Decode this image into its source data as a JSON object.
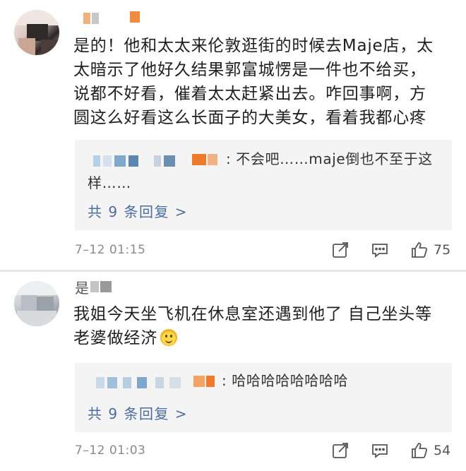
{
  "comments": [
    {
      "text": "是的！他和太太来伦敦逛街的时候去Maje店，太\n太暗示了他好久结果郭富城愣是一件也不给买，\n说都不好看，催着太太赶紧出去。咋回事啊，方\n圆这么好看这么长面子的大美女，看着我都心疼",
      "reply_text": ": 不会吧……maje倒也不至于这",
      "reply_text_cont": "样……",
      "reply_more": "共 9 条回复 >",
      "time": "7–12 01:15",
      "likes": "75"
    },
    {
      "text": "我姐今天坐飞机在休息室还遇到他了 自己坐头等\n老婆做经济",
      "reply_text": ": 哈哈哈哈哈哈哈哈",
      "reply_more": "共 9 条回复 >",
      "time": "7–12 01:03",
      "likes": "54"
    }
  ],
  "second_username_char": "是",
  "icons": {
    "share": "share-icon",
    "comment": "comment-icon",
    "like": "thumbs-up-icon",
    "emoji": "smile-emoji-icon"
  },
  "colors": {
    "link": "#4a6ea0",
    "reply_bg": "#f4f4f4",
    "meta": "#8a8a8a"
  }
}
